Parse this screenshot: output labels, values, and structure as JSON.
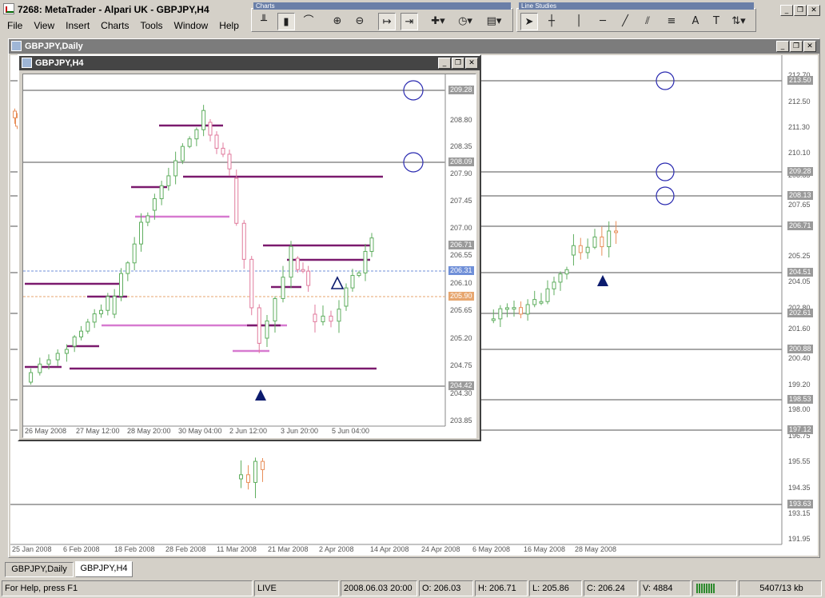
{
  "app": {
    "title": "7268: MetaTrader - Alpari UK - GBPJPY,H4"
  },
  "menu": [
    "File",
    "View",
    "Insert",
    "Charts",
    "Tools",
    "Window",
    "Help"
  ],
  "toolbars": {
    "charts_caption": "Charts",
    "line_studies_caption": "Line Studies"
  },
  "daily": {
    "title": "GBPJPY,Daily",
    "y_ticks": [
      "212.70",
      "212.50",
      "211.30",
      "210.10",
      "208.85",
      "207.65",
      "206.45",
      "205.25",
      "204.05",
      "202.80",
      "201.60",
      "200.40",
      "199.20",
      "198.00",
      "196.75",
      "195.55",
      "194.35",
      "193.15",
      "191.95"
    ],
    "price_tags": [
      {
        "value": "213.50",
        "color": "#9a9a9a"
      },
      {
        "value": "209.28",
        "color": "#9a9a9a"
      },
      {
        "value": "208.13",
        "color": "#9a9a9a"
      },
      {
        "value": "206.71",
        "color": "#9a9a9a"
      },
      {
        "value": "204.51",
        "color": "#9a9a9a"
      },
      {
        "value": "202.61",
        "color": "#9a9a9a"
      },
      {
        "value": "200.88",
        "color": "#9a9a9a"
      },
      {
        "value": "198.53",
        "color": "#9a9a9a"
      },
      {
        "value": "197.12",
        "color": "#9a9a9a"
      },
      {
        "value": "193.63",
        "color": "#9a9a9a"
      }
    ],
    "x_ticks": [
      "25 Jan 2008",
      "6 Feb 2008",
      "18 Feb 2008",
      "28 Feb 2008",
      "11 Mar 2008",
      "21 Mar 2008",
      "2 Apr 2008",
      "14 Apr 2008",
      "24 Apr 2008",
      "6 May 2008",
      "16 May 2008",
      "28 May 2008"
    ]
  },
  "h4": {
    "title": "GBPJPY,H4",
    "y_ticks": [
      "208.80",
      "208.35",
      "207.90",
      "207.45",
      "207.00",
      "206.55",
      "206.10",
      "205.65",
      "205.20",
      "204.75",
      "204.30",
      "203.85"
    ],
    "price_tags": [
      {
        "value": "209.28",
        "color": "#9a9a9a"
      },
      {
        "value": "208.09",
        "color": "#9a9a9a"
      },
      {
        "value": "206.71",
        "color": "#9a9a9a"
      },
      {
        "value": "206.31",
        "color": "#6f8fd8"
      },
      {
        "value": "205.90",
        "color": "#e7a66f"
      },
      {
        "value": "204.42",
        "color": "#9a9a9a"
      }
    ],
    "x_ticks": [
      "26 May 2008",
      "27 May 12:00",
      "28 May 20:00",
      "30 May 04:00",
      "2 Jun 12:00",
      "3 Jun 20:00",
      "5 Jun 04:00"
    ]
  },
  "tabs": [
    "GBPJPY,Daily",
    "GBPJPY,H4"
  ],
  "status": {
    "help": "For Help, press F1",
    "conn": "LIVE",
    "time": "2008.06.03 20:00",
    "open": "O: 206.03",
    "high": "H: 206.71",
    "low": "L: 205.86",
    "close": "C: 206.24",
    "volume": "V: 4884",
    "traffic": "5407/13 kb"
  },
  "colors": {
    "bull": "#5fae5f",
    "bear_h4": "#e07a9c",
    "bear_daily": "#e88f5a",
    "level": "#7b1a6e",
    "level_light": "#d77ad0",
    "circle": "#2a2ab0",
    "arrow": "#0c1b6e"
  }
}
